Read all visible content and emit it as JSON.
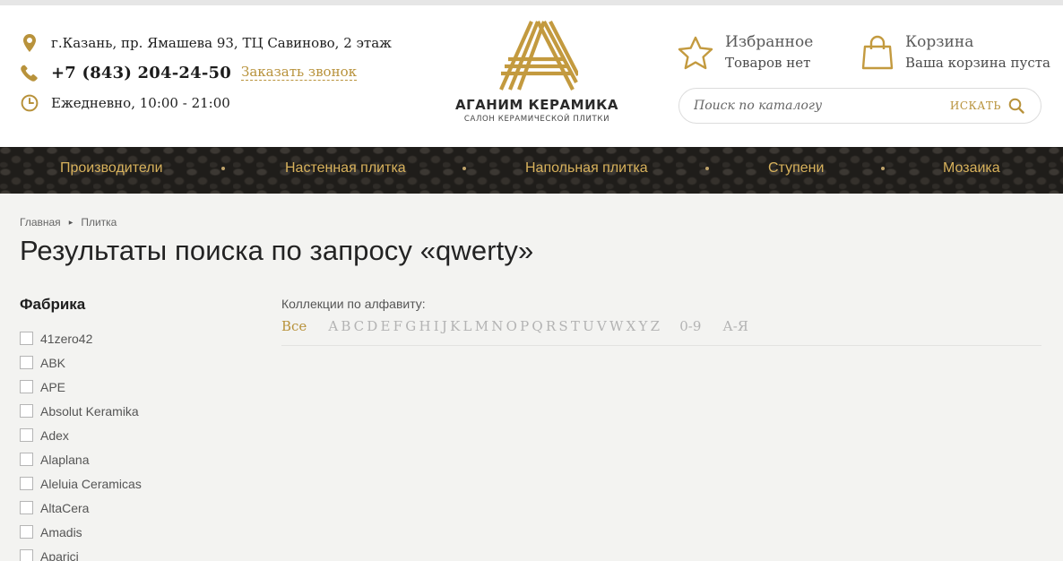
{
  "header": {
    "address": "г.Казань, пр. Ямашева 93, ТЦ Савиново, 2 этаж",
    "phone": "+7 (843) 204-24-50",
    "callback_label": "Заказать звонок",
    "hours": "Ежедневно, 10:00 - 21:00",
    "logo": {
      "brand": "АГАНИМ КЕРАМИКА",
      "tagline": "САЛОН КЕРАМИЧЕСКОЙ ПЛИТКИ"
    },
    "favorites": {
      "title": "Избранное",
      "status": "Товаров нет"
    },
    "cart": {
      "title": "Корзина",
      "status": "Ваша корзина пуста"
    },
    "search": {
      "placeholder": "Поиск по каталогу",
      "button_label": "ИСКАТЬ"
    },
    "accent_color": "#b8923b"
  },
  "nav": {
    "items": [
      "Производители",
      "Настенная плитка",
      "Напольная плитка",
      "Ступени",
      "Мозаика"
    ],
    "text_color": "#d8b25c"
  },
  "breadcrumb": [
    "Главная",
    "Плитка"
  ],
  "page_title": "Результаты поиска по запросу «qwerty»",
  "filter": {
    "title": "Фабрика",
    "items": [
      "41zero42",
      "ABK",
      "APE",
      "Absolut Keramika",
      "Adex",
      "Alaplana",
      "Aleluia Ceramicas",
      "AltaCera",
      "Amadis",
      "Aparici"
    ]
  },
  "alphabet": {
    "label": "Коллекции по алфавиту:",
    "all_label": "Все",
    "letters": [
      "A",
      "B",
      "C",
      "D",
      "E",
      "F",
      "G",
      "H",
      "I",
      "J",
      "K",
      "L",
      "M",
      "N",
      "O",
      "P",
      "Q",
      "R",
      "S",
      "T",
      "U",
      "V",
      "W",
      "X",
      "Y",
      "Z"
    ],
    "digits_label": "0-9",
    "cyrillic_label": "А-Я"
  }
}
